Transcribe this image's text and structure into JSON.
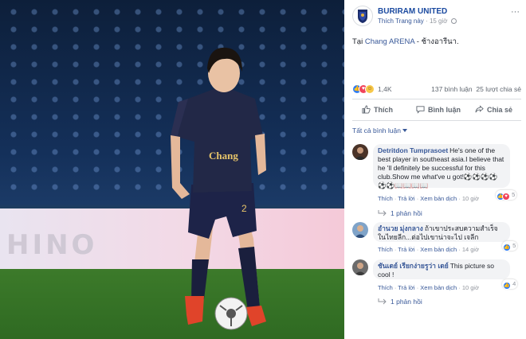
{
  "photo": {
    "board_text": "HINO",
    "shirt_sponsor": "Chang",
    "shirt_number": "2"
  },
  "post": {
    "page_name": "BURIRAM UNITED",
    "like_page": "Thích Trang này",
    "time": "15 giờ",
    "text_prefix": "Tại ",
    "text_link": "Chang ARENA",
    "text_suffix": " - ช้างอารีนา.",
    "reaction_count": "1,4K",
    "comment_count": "137 bình luận",
    "share_count": "25 lượt chia sẻ"
  },
  "actions": {
    "like": "Thích",
    "comment": "Bình luận",
    "share": "Chia sẻ"
  },
  "filter_label": "Tất cả bình luận",
  "comments": [
    {
      "name": "Detritdon Tumprasoet",
      "text": "He's one of the best player in southeast asia.I believe that he 'll definitely be successful for this club.Show me what've u got!⚽⚽⚽⚽⚽⚽📖📖📖📖",
      "like": "Thích",
      "reply": "Trả lời",
      "translate": "Xem bản dịch",
      "time": "10 giờ",
      "reactions": "5",
      "replies": "1 phản hồi"
    },
    {
      "name": "อำนวย มุ่งกลาง",
      "text": "ถ้าเขาประสบความสำเร็จในไทยลีก...ต่อไปเขาน่าจะไป เจลีก",
      "like": "Thích",
      "reply": "Trả lời",
      "translate": "Xem bản dịch",
      "time": "14 giờ",
      "reactions": "5"
    },
    {
      "name": "ชันเดย์ เรียกง่ายรูว่า เดย์",
      "text": "This picture so cool !",
      "like": "Thích",
      "reply": "Trả lời",
      "translate": "Xem bản dịch",
      "time": "10 giờ",
      "reactions": "4",
      "replies": "1 phản hồi"
    }
  ],
  "colors": {
    "link": "#385898",
    "page_name": "#1b4aa0",
    "like_blue": "#2f7df6",
    "love_red": "#f0435a",
    "haha_yellow": "#f7c84a"
  }
}
